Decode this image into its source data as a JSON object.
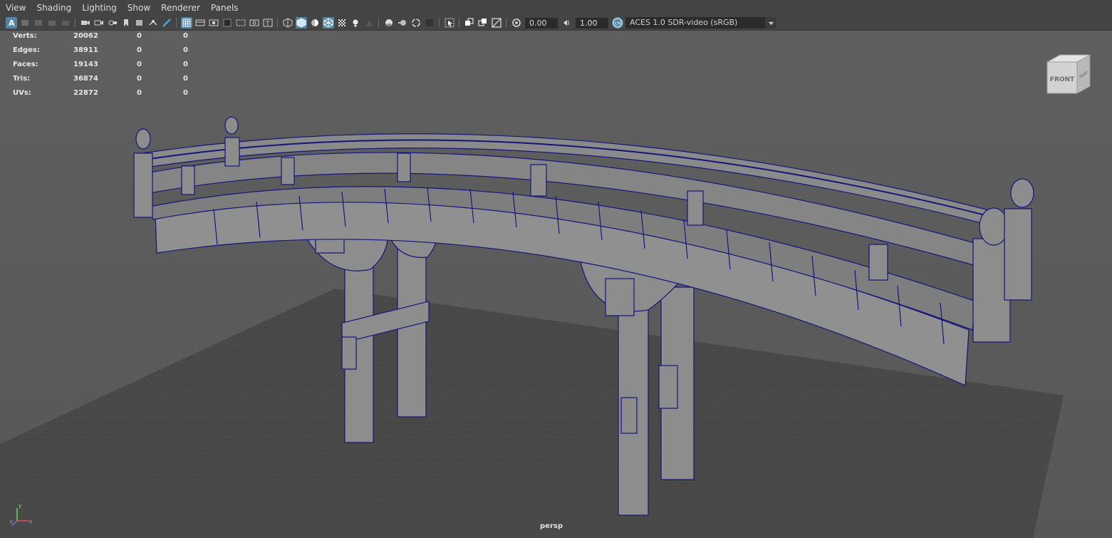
{
  "menu": [
    "View",
    "Shading",
    "Lighting",
    "Show",
    "Renderer",
    "Panels"
  ],
  "toolbar": {
    "exposure": "0.00",
    "gamma": "1.00",
    "color_space": "ACES 1.0 SDR-video (sRGB)",
    "icons": [
      "select-camera-icon",
      "camera-attributes-icon",
      "bookmark-icon",
      "image-plane-icon",
      "2d-pan-zoom-icon",
      "grease-pencil-icon",
      "grid-icon",
      "film-gate-icon",
      "resolution-gate-icon",
      "gate-mask-icon",
      "field-chart-icon",
      "safe-action-icon",
      "safe-title-icon",
      "wireframe-icon",
      "smooth-shade-icon",
      "default-material-icon",
      "wireframe-on-shaded-icon",
      "xray-icon",
      "textured-icon",
      "use-all-lights-icon",
      "shadows-icon",
      "screen-space-ao-icon",
      "motion-blur-icon",
      "anti-aliasing-icon",
      "depth-of-field-icon",
      "isolate-select-icon",
      "xray-joints-icon",
      "xray-active-icon",
      "backface-culling-icon",
      "exposure-icon",
      "gamma-icon",
      "color-management-icon"
    ]
  },
  "hud": {
    "rows": [
      {
        "label": "Verts:",
        "value": "20062",
        "sel": "0",
        "comp": "0"
      },
      {
        "label": "Edges:",
        "value": "38911",
        "sel": "0",
        "comp": "0"
      },
      {
        "label": "Faces:",
        "value": "19143",
        "sel": "0",
        "comp": "0"
      },
      {
        "label": "Tris:",
        "value": "36874",
        "sel": "0",
        "comp": "0"
      },
      {
        "label": "UVs:",
        "value": "22872",
        "sel": "0",
        "comp": "0"
      }
    ]
  },
  "viewcube": {
    "front": "FRONT",
    "right": "RIGHT"
  },
  "camera": "persp",
  "axis": {
    "x": "x",
    "y": "y",
    "z": "z"
  },
  "colors": {
    "wire": "#15157a",
    "mesh": "#8c8c8c",
    "grid": "#3a3a3a",
    "accent": "#5285a6"
  }
}
